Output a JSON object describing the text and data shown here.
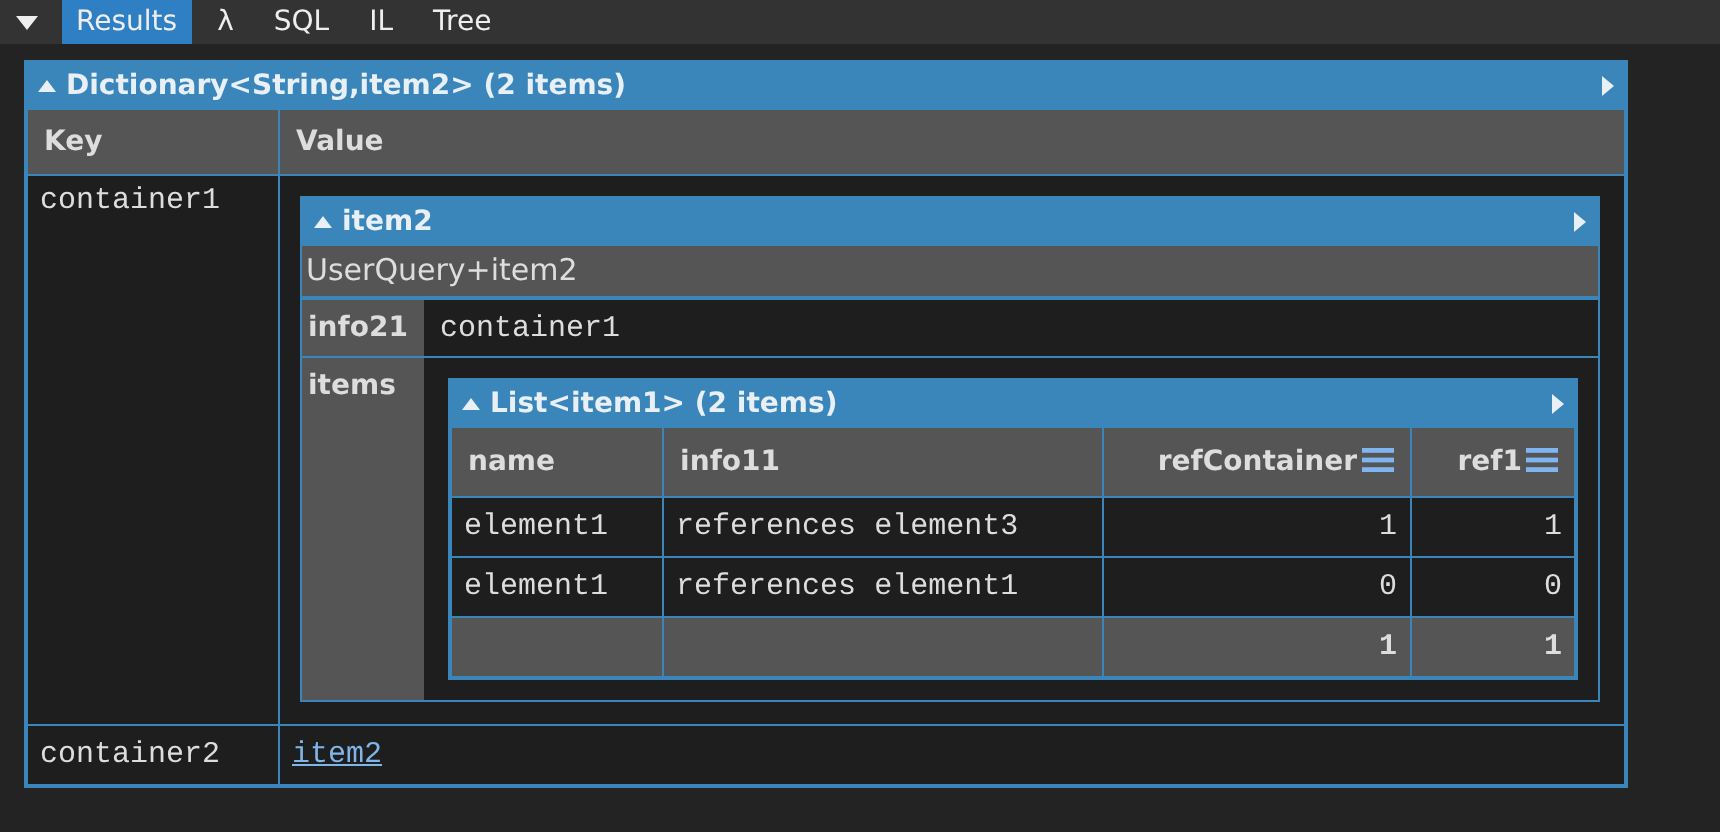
{
  "tabs": [
    {
      "label": "Results",
      "selected": true
    },
    {
      "label": "λ",
      "selected": false
    },
    {
      "label": "SQL",
      "selected": false
    },
    {
      "label": "IL",
      "selected": false
    },
    {
      "label": "Tree",
      "selected": false
    }
  ],
  "result": {
    "title": "Dictionary<String,item2> (2 items)",
    "columns": [
      "Key",
      "Value"
    ],
    "rows": [
      {
        "key": "container1",
        "value": {
          "kind": "object",
          "title": "item2",
          "type_name": "UserQuery+item2",
          "fields": [
            {
              "name": "info21",
              "kind": "text",
              "value": "container1"
            },
            {
              "name": "items",
              "kind": "list",
              "list": {
                "title": "List<item1> (2 items)",
                "columns": [
                  {
                    "label": "name",
                    "numeric": false
                  },
                  {
                    "label": "info11",
                    "numeric": false
                  },
                  {
                    "label": "refContainer",
                    "numeric": true
                  },
                  {
                    "label": "ref1",
                    "numeric": true
                  }
                ],
                "rows": [
                  [
                    "element1",
                    "references element3",
                    "1",
                    "1"
                  ],
                  [
                    "element1",
                    "references element1",
                    "0",
                    "0"
                  ]
                ],
                "totals": [
                  "1",
                  "1"
                ]
              }
            }
          ]
        }
      },
      {
        "key": "container2",
        "value": {
          "kind": "link",
          "text": "item2"
        }
      }
    ]
  }
}
